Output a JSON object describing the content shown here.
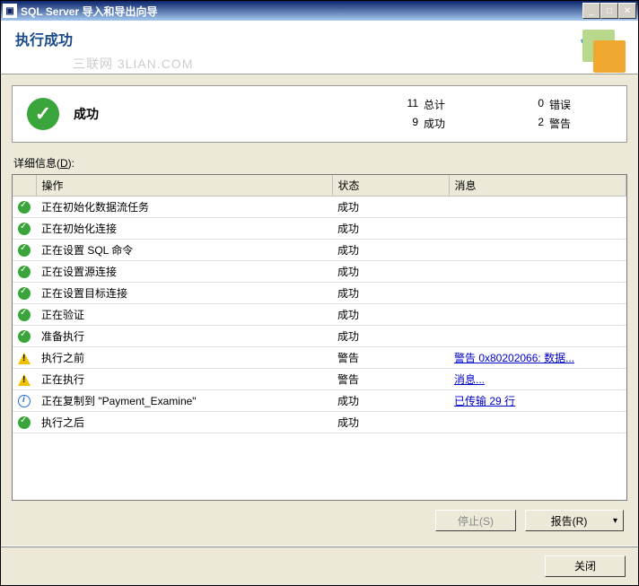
{
  "window": {
    "title": "SQL Server 导入和导出向导"
  },
  "header": {
    "title": "执行成功",
    "watermark": "三联网 3LIAN.COM"
  },
  "summary": {
    "title": "成功",
    "stats_left": [
      {
        "num": "11",
        "label": "总计"
      },
      {
        "num": "9",
        "label": "成功"
      }
    ],
    "stats_right": [
      {
        "num": "0",
        "label": "错误"
      },
      {
        "num": "2",
        "label": "警告"
      }
    ]
  },
  "details_label_prefix": "详细信息(",
  "details_label_key": "D",
  "details_label_suffix": "):",
  "columns": {
    "op": "操作",
    "status": "状态",
    "msg": "消息"
  },
  "rows": [
    {
      "icon": "success",
      "op": "正在初始化数据流任务",
      "status": "成功",
      "msg": "",
      "link": false
    },
    {
      "icon": "success",
      "op": "正在初始化连接",
      "status": "成功",
      "msg": "",
      "link": false
    },
    {
      "icon": "success",
      "op": "正在设置 SQL 命令",
      "status": "成功",
      "msg": "",
      "link": false
    },
    {
      "icon": "success",
      "op": "正在设置源连接",
      "status": "成功",
      "msg": "",
      "link": false
    },
    {
      "icon": "success",
      "op": "正在设置目标连接",
      "status": "成功",
      "msg": "",
      "link": false
    },
    {
      "icon": "success",
      "op": "正在验证",
      "status": "成功",
      "msg": "",
      "link": false
    },
    {
      "icon": "success",
      "op": "准备执行",
      "status": "成功",
      "msg": "",
      "link": false
    },
    {
      "icon": "warn",
      "op": "执行之前",
      "status": "警告",
      "msg": "警告 0x80202066: 数据...",
      "link": true
    },
    {
      "icon": "warn",
      "op": "正在执行",
      "status": "警告",
      "msg": "消息...",
      "link": true
    },
    {
      "icon": "info",
      "op": "正在复制到 \"Payment_Examine\"",
      "status": "成功",
      "msg": "已传输 29 行",
      "link": true
    },
    {
      "icon": "success",
      "op": "执行之后",
      "status": "成功",
      "msg": "",
      "link": false
    }
  ],
  "buttons": {
    "stop": "停止(S)",
    "report": "报告(R)",
    "close": "关闭"
  }
}
